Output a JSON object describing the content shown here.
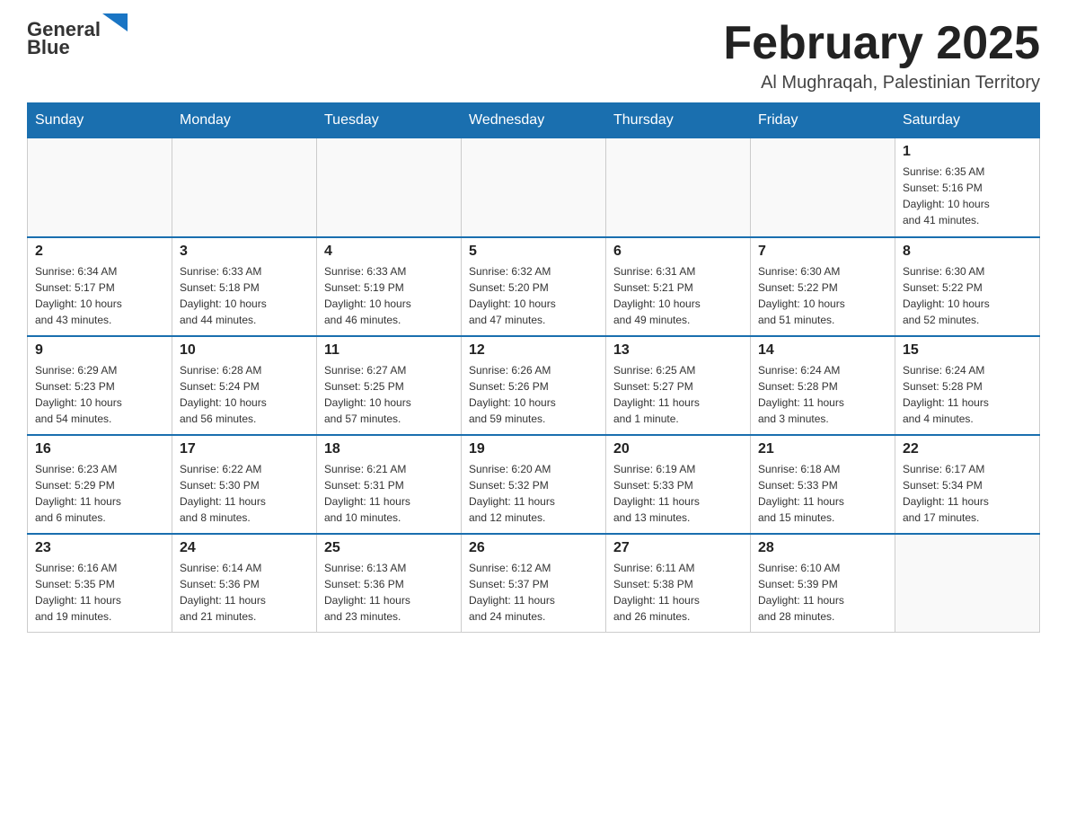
{
  "header": {
    "logo_general": "General",
    "logo_blue": "Blue",
    "month_title": "February 2025",
    "location": "Al Mughraqah, Palestinian Territory"
  },
  "weekdays": [
    "Sunday",
    "Monday",
    "Tuesday",
    "Wednesday",
    "Thursday",
    "Friday",
    "Saturday"
  ],
  "weeks": [
    [
      {
        "day": "",
        "info": ""
      },
      {
        "day": "",
        "info": ""
      },
      {
        "day": "",
        "info": ""
      },
      {
        "day": "",
        "info": ""
      },
      {
        "day": "",
        "info": ""
      },
      {
        "day": "",
        "info": ""
      },
      {
        "day": "1",
        "info": "Sunrise: 6:35 AM\nSunset: 5:16 PM\nDaylight: 10 hours\nand 41 minutes."
      }
    ],
    [
      {
        "day": "2",
        "info": "Sunrise: 6:34 AM\nSunset: 5:17 PM\nDaylight: 10 hours\nand 43 minutes."
      },
      {
        "day": "3",
        "info": "Sunrise: 6:33 AM\nSunset: 5:18 PM\nDaylight: 10 hours\nand 44 minutes."
      },
      {
        "day": "4",
        "info": "Sunrise: 6:33 AM\nSunset: 5:19 PM\nDaylight: 10 hours\nand 46 minutes."
      },
      {
        "day": "5",
        "info": "Sunrise: 6:32 AM\nSunset: 5:20 PM\nDaylight: 10 hours\nand 47 minutes."
      },
      {
        "day": "6",
        "info": "Sunrise: 6:31 AM\nSunset: 5:21 PM\nDaylight: 10 hours\nand 49 minutes."
      },
      {
        "day": "7",
        "info": "Sunrise: 6:30 AM\nSunset: 5:22 PM\nDaylight: 10 hours\nand 51 minutes."
      },
      {
        "day": "8",
        "info": "Sunrise: 6:30 AM\nSunset: 5:22 PM\nDaylight: 10 hours\nand 52 minutes."
      }
    ],
    [
      {
        "day": "9",
        "info": "Sunrise: 6:29 AM\nSunset: 5:23 PM\nDaylight: 10 hours\nand 54 minutes."
      },
      {
        "day": "10",
        "info": "Sunrise: 6:28 AM\nSunset: 5:24 PM\nDaylight: 10 hours\nand 56 minutes."
      },
      {
        "day": "11",
        "info": "Sunrise: 6:27 AM\nSunset: 5:25 PM\nDaylight: 10 hours\nand 57 minutes."
      },
      {
        "day": "12",
        "info": "Sunrise: 6:26 AM\nSunset: 5:26 PM\nDaylight: 10 hours\nand 59 minutes."
      },
      {
        "day": "13",
        "info": "Sunrise: 6:25 AM\nSunset: 5:27 PM\nDaylight: 11 hours\nand 1 minute."
      },
      {
        "day": "14",
        "info": "Sunrise: 6:24 AM\nSunset: 5:28 PM\nDaylight: 11 hours\nand 3 minutes."
      },
      {
        "day": "15",
        "info": "Sunrise: 6:24 AM\nSunset: 5:28 PM\nDaylight: 11 hours\nand 4 minutes."
      }
    ],
    [
      {
        "day": "16",
        "info": "Sunrise: 6:23 AM\nSunset: 5:29 PM\nDaylight: 11 hours\nand 6 minutes."
      },
      {
        "day": "17",
        "info": "Sunrise: 6:22 AM\nSunset: 5:30 PM\nDaylight: 11 hours\nand 8 minutes."
      },
      {
        "day": "18",
        "info": "Sunrise: 6:21 AM\nSunset: 5:31 PM\nDaylight: 11 hours\nand 10 minutes."
      },
      {
        "day": "19",
        "info": "Sunrise: 6:20 AM\nSunset: 5:32 PM\nDaylight: 11 hours\nand 12 minutes."
      },
      {
        "day": "20",
        "info": "Sunrise: 6:19 AM\nSunset: 5:33 PM\nDaylight: 11 hours\nand 13 minutes."
      },
      {
        "day": "21",
        "info": "Sunrise: 6:18 AM\nSunset: 5:33 PM\nDaylight: 11 hours\nand 15 minutes."
      },
      {
        "day": "22",
        "info": "Sunrise: 6:17 AM\nSunset: 5:34 PM\nDaylight: 11 hours\nand 17 minutes."
      }
    ],
    [
      {
        "day": "23",
        "info": "Sunrise: 6:16 AM\nSunset: 5:35 PM\nDaylight: 11 hours\nand 19 minutes."
      },
      {
        "day": "24",
        "info": "Sunrise: 6:14 AM\nSunset: 5:36 PM\nDaylight: 11 hours\nand 21 minutes."
      },
      {
        "day": "25",
        "info": "Sunrise: 6:13 AM\nSunset: 5:36 PM\nDaylight: 11 hours\nand 23 minutes."
      },
      {
        "day": "26",
        "info": "Sunrise: 6:12 AM\nSunset: 5:37 PM\nDaylight: 11 hours\nand 24 minutes."
      },
      {
        "day": "27",
        "info": "Sunrise: 6:11 AM\nSunset: 5:38 PM\nDaylight: 11 hours\nand 26 minutes."
      },
      {
        "day": "28",
        "info": "Sunrise: 6:10 AM\nSunset: 5:39 PM\nDaylight: 11 hours\nand 28 minutes."
      },
      {
        "day": "",
        "info": ""
      }
    ]
  ]
}
